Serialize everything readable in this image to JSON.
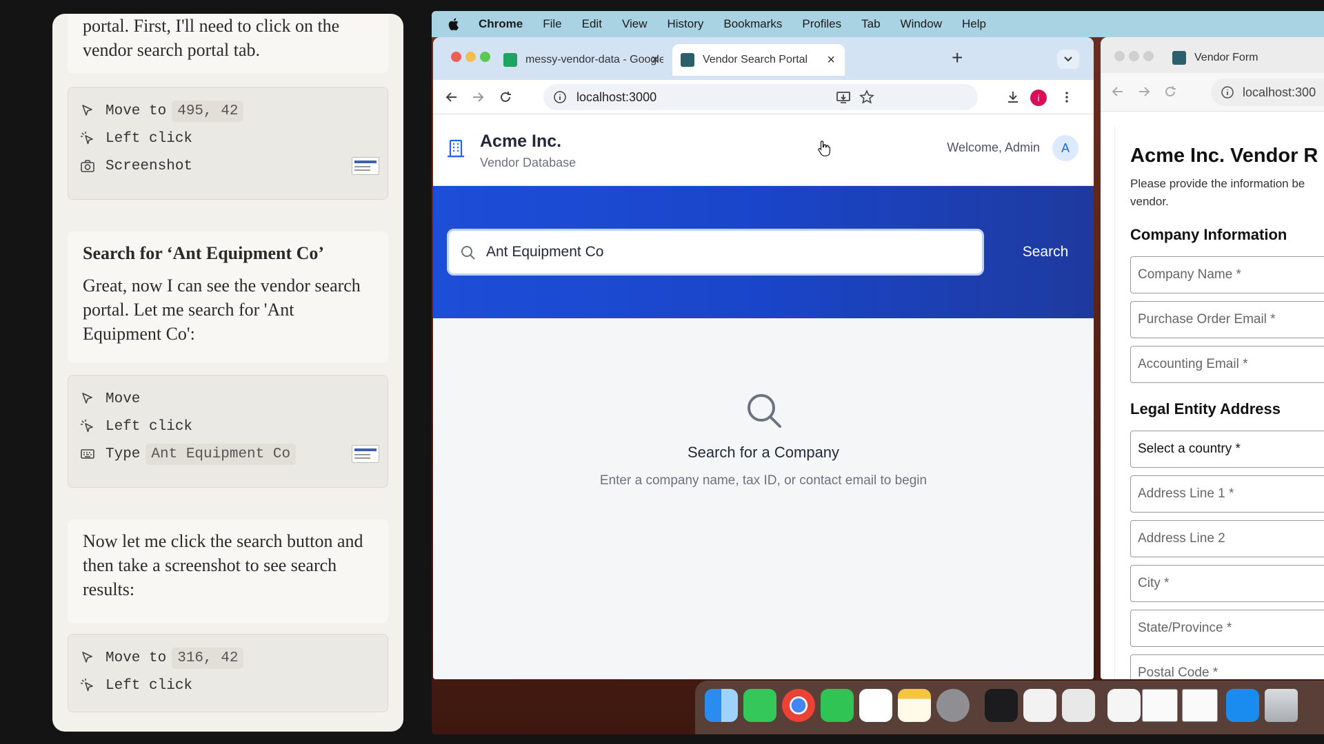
{
  "chat": {
    "intro_text": "portal. First, I'll need to click on the vendor search portal tab.",
    "group1": [
      {
        "icon": "cursor-move-icon",
        "label": "Move to",
        "value": "495, 42"
      },
      {
        "icon": "cursor-click-icon",
        "label": "Left click",
        "value": ""
      },
      {
        "icon": "camera-icon",
        "label": "Screenshot",
        "value": ""
      }
    ],
    "search_heading": "Search for ‘Ant Equipment Co’",
    "search_text": "Great, now I can see the vendor search portal. Let me search for 'Ant Equipment Co':",
    "group2": [
      {
        "icon": "cursor-move-icon",
        "label": "Move",
        "value": ""
      },
      {
        "icon": "cursor-click-icon",
        "label": "Left click",
        "value": ""
      },
      {
        "icon": "keyboard-icon",
        "label": "Type",
        "value": "Ant Equipment Co"
      }
    ],
    "next_text": "Now let me click the search button and then take a screenshot to see search results:",
    "group3": [
      {
        "icon": "cursor-move-icon",
        "label": "Move to",
        "value": "316, 42"
      },
      {
        "icon": "cursor-click-icon",
        "label": "Left click",
        "value": ""
      }
    ]
  },
  "menubar": {
    "app": "Chrome",
    "items": [
      "File",
      "Edit",
      "View",
      "History",
      "Bookmarks",
      "Profiles",
      "Tab",
      "Window",
      "Help"
    ]
  },
  "browser": {
    "tabs": [
      {
        "title": "messy-vendor-data - Google",
        "favicon_color": "#1ea362"
      },
      {
        "title": "Vendor Search Portal",
        "favicon_color": "#2b5f6b"
      }
    ],
    "url": "localhost:3000",
    "profile_initial": "i"
  },
  "app": {
    "company": "Acme Inc.",
    "subtitle": "Vendor Database",
    "welcome": "Welcome, Admin",
    "avatar_initial": "A",
    "search_value": "Ant Equipment Co",
    "search_button": "Search",
    "empty_title": "Search for a Company",
    "empty_subtitle": "Enter a company name, tax ID, or contact email to begin"
  },
  "browser2": {
    "tab_title": "Vendor Form",
    "url": "localhost:300",
    "form_title": "Acme Inc. Vendor R",
    "form_desc": "Please provide the information be vendor.",
    "section1": "Company Information",
    "fields1": [
      "Company Name *",
      "Purchase Order Email *",
      "Accounting Email *"
    ],
    "section2": "Legal Entity Address",
    "fields2": [
      "Select a country *",
      "Address Line 1 *",
      "Address Line 2",
      "City *",
      "State/Province *",
      "Postal Code *"
    ]
  },
  "colors": {
    "accent_blue": "#1d4ed8",
    "tab_strip": "#d3e3f3",
    "menubar": "#a9d3e2"
  }
}
